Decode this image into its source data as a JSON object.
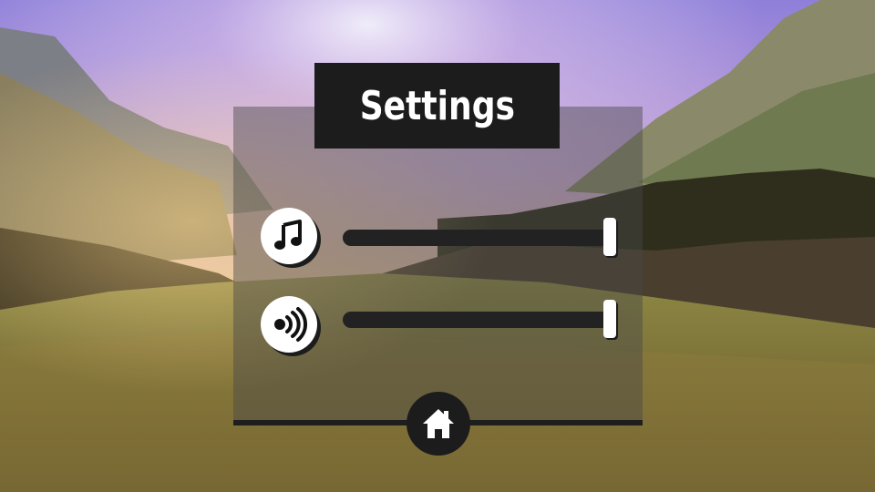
{
  "title": "Settings",
  "settings": {
    "music": {
      "icon": "music-note-icon",
      "level": 1.0
    },
    "sound": {
      "icon": "speaker-icon",
      "level": 1.0
    }
  },
  "home_button": {
    "icon": "home-icon"
  },
  "colors": {
    "panel_dark": "#1c1c1c",
    "icon_bg": "#ffffff",
    "track": "#222222"
  }
}
